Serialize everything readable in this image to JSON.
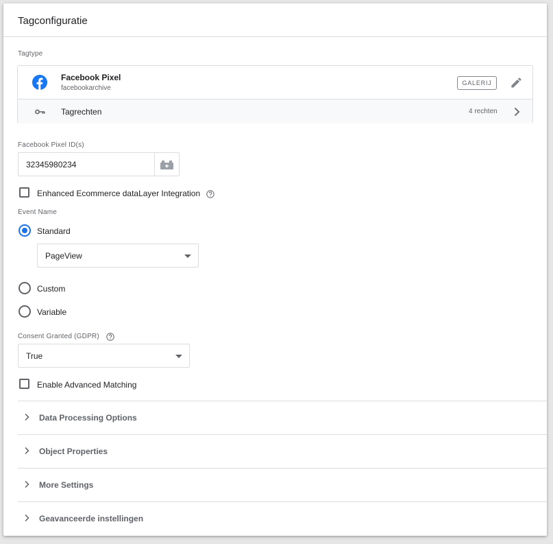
{
  "card": {
    "title": "Tagconfiguratie"
  },
  "tagtype": {
    "label": "Tagtype",
    "name": "Facebook Pixel",
    "subtitle": "facebookarchive",
    "gallery_button": "GALERIJ",
    "rights_label": "Tagrechten",
    "rights_count": "4 rechten",
    "icon": "facebook-icon"
  },
  "pixel_id": {
    "label": "Facebook Pixel ID(s)",
    "value": "32345980234"
  },
  "ecommerce": {
    "label": "Enhanced Ecommerce dataLayer Integration",
    "checked": false
  },
  "event_name": {
    "label": "Event Name",
    "options": [
      {
        "label": "Standard",
        "selected": true
      },
      {
        "label": "Custom",
        "selected": false
      },
      {
        "label": "Variable",
        "selected": false
      }
    ],
    "standard_value": "PageView"
  },
  "consent": {
    "label": "Consent Granted (GDPR)",
    "value": "True"
  },
  "advanced_matching": {
    "label": "Enable Advanced Matching",
    "checked": false
  },
  "sections": [
    {
      "label": "Data Processing Options"
    },
    {
      "label": "Object Properties"
    },
    {
      "label": "More Settings"
    },
    {
      "label": "Geavanceerde instellingen"
    }
  ],
  "colors": {
    "accent": "#1a73e8",
    "facebook": "#1877f2"
  }
}
